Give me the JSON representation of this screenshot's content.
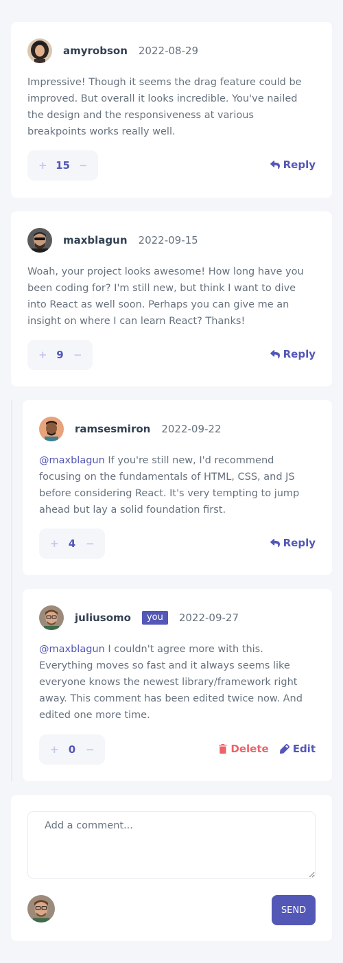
{
  "comments": [
    {
      "username": "amyrobson",
      "date": "2022-08-29",
      "content": "Impressive! Though it seems the drag feature could be improved. But overall it looks incredible. You've nailed the design and the responsiveness at various breakpoints works really well.",
      "score": "15",
      "reply_label": "Reply"
    },
    {
      "username": "maxblagun",
      "date": "2022-09-15",
      "content": "Woah, your project looks awesome! How long have you been coding for? I'm still new, but think I want to dive into React as well soon. Perhaps you can give me an insight on where I can learn React? Thanks!",
      "score": "9",
      "reply_label": "Reply"
    }
  ],
  "replies": [
    {
      "username": "ramsesmiron",
      "date": "2022-09-22",
      "mention": "@maxblagun",
      "content": "If you're still new, I'd recommend focusing on the fundamentals of HTML, CSS, and JS before considering React. It's very tempting to jump ahead but lay a solid foundation first.",
      "score": "4",
      "reply_label": "Reply"
    },
    {
      "username": "juliusomo",
      "you_badge": "you",
      "date": "2022-09-27",
      "mention": "@maxblagun",
      "content": "I couldn't agree more with this. Everything moves so fast and it always seems like everyone knows the newest library/framework right away. This comment has been edited twice now. And edited one more time.",
      "score": "0",
      "delete_label": "Delete",
      "edit_label": "Edit"
    }
  ],
  "vote": {
    "plus": "+",
    "minus": "−"
  },
  "new_comment": {
    "placeholder": "Add a comment...",
    "send_label": "SEND"
  },
  "colors": {
    "primary": "#5357b6",
    "danger": "#ed6368",
    "background": "#f5f6fa",
    "text": "#67727e",
    "heading": "#324152",
    "vote_button": "#c5c6ef"
  },
  "icons": [
    "reply-icon",
    "delete-icon",
    "edit-icon"
  ]
}
